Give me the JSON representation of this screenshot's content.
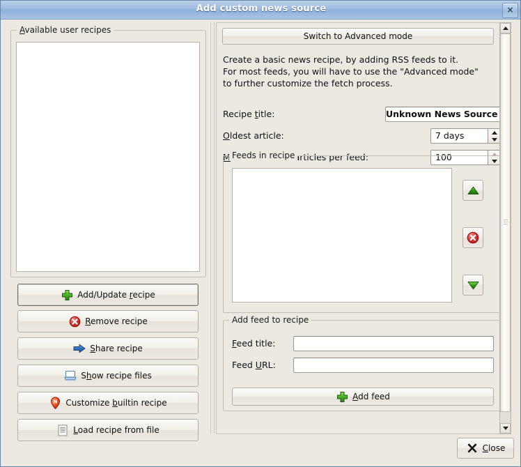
{
  "window": {
    "title": "Add custom news source",
    "close_button": "×",
    "close_icon": "window-close-icon"
  },
  "left_pane": {
    "group_title": "Available user recipes",
    "list_items": [],
    "buttons": [
      {
        "id": "add-update-recipe",
        "label_pre": "Add/Update ",
        "label_key": "r",
        "label_post": "ecipe",
        "icon": "plus-green-icon",
        "default": true
      },
      {
        "id": "remove-recipe",
        "label_pre": "",
        "label_key": "R",
        "label_post": "emove recipe",
        "icon": "delete-red-icon",
        "default": false
      },
      {
        "id": "share-recipe",
        "label_pre": "",
        "label_key": "S",
        "label_post": "hare recipe",
        "icon": "arrow-right-blue-icon",
        "default": false
      },
      {
        "id": "show-recipe-files",
        "label_pre": "S",
        "label_key": "h",
        "label_post": "ow recipe files",
        "icon": "folder-open-icon",
        "default": false
      },
      {
        "id": "customize-builtin-recipe",
        "label_pre": "Customize ",
        "label_key": "b",
        "label_post": "uiltin recipe",
        "icon": "news-pin-icon",
        "default": false
      },
      {
        "id": "load-recipe-from-file",
        "label_pre": "",
        "label_key": "L",
        "label_post": "oad recipe from file",
        "icon": "document-icon",
        "default": false
      }
    ]
  },
  "right_pane": {
    "advanced_button": "Switch to Advanced mode",
    "description": "Create a basic news recipe, by adding RSS feeds to it.\nFor most feeds, you will have to use the \"Advanced mode\"\nto further customize the fetch process.",
    "fields": {
      "recipe_title_label_pre": "Recipe ",
      "recipe_title_label_key": "t",
      "recipe_title_label_post": "itle:",
      "recipe_title_value": "Unknown News Source",
      "oldest_article_label_key": "O",
      "oldest_article_label_post": "ldest article:",
      "oldest_article_value": "7 days",
      "max_articles_label_key": "M",
      "max_articles_label_post": "ax. number of articles per feed:",
      "max_articles_value": "100"
    },
    "feeds_group": {
      "title": "Feeds in recipe",
      "items": [],
      "move_up_icon": "arrow-up-green-icon",
      "delete_icon": "delete-red-icon",
      "move_down_icon": "arrow-down-green-icon"
    },
    "add_feed_group": {
      "title": "Add feed to recipe",
      "feed_title_label_key": "F",
      "feed_title_label_post": "eed title:",
      "feed_title_value": "",
      "feed_title_placeholder": "",
      "feed_url_label_pre": "Feed ",
      "feed_url_label_key": "U",
      "feed_url_label_post": "RL:",
      "feed_url_value": "",
      "feed_url_placeholder": "",
      "add_feed_label_key": "A",
      "add_feed_label_post": "dd feed",
      "add_feed_icon": "plus-green-icon"
    }
  },
  "scrollbar": {
    "up_icon": "scroll-up-icon",
    "down_icon": "scroll-down-icon",
    "position": "top"
  },
  "footer": {
    "close_label_key": "C",
    "close_label_post": "lose",
    "close_icon": "x-mark-icon"
  },
  "colors": {
    "window_bg": "#ece9e3",
    "titlebar_from": "#b9d0ea",
    "titlebar_to": "#8fb0d8",
    "accent_green": "#3f9b20",
    "accent_red": "#d02323",
    "accent_blue": "#2f6fc0",
    "field_bg": "#ffffff",
    "border": "#b2aea6"
  }
}
